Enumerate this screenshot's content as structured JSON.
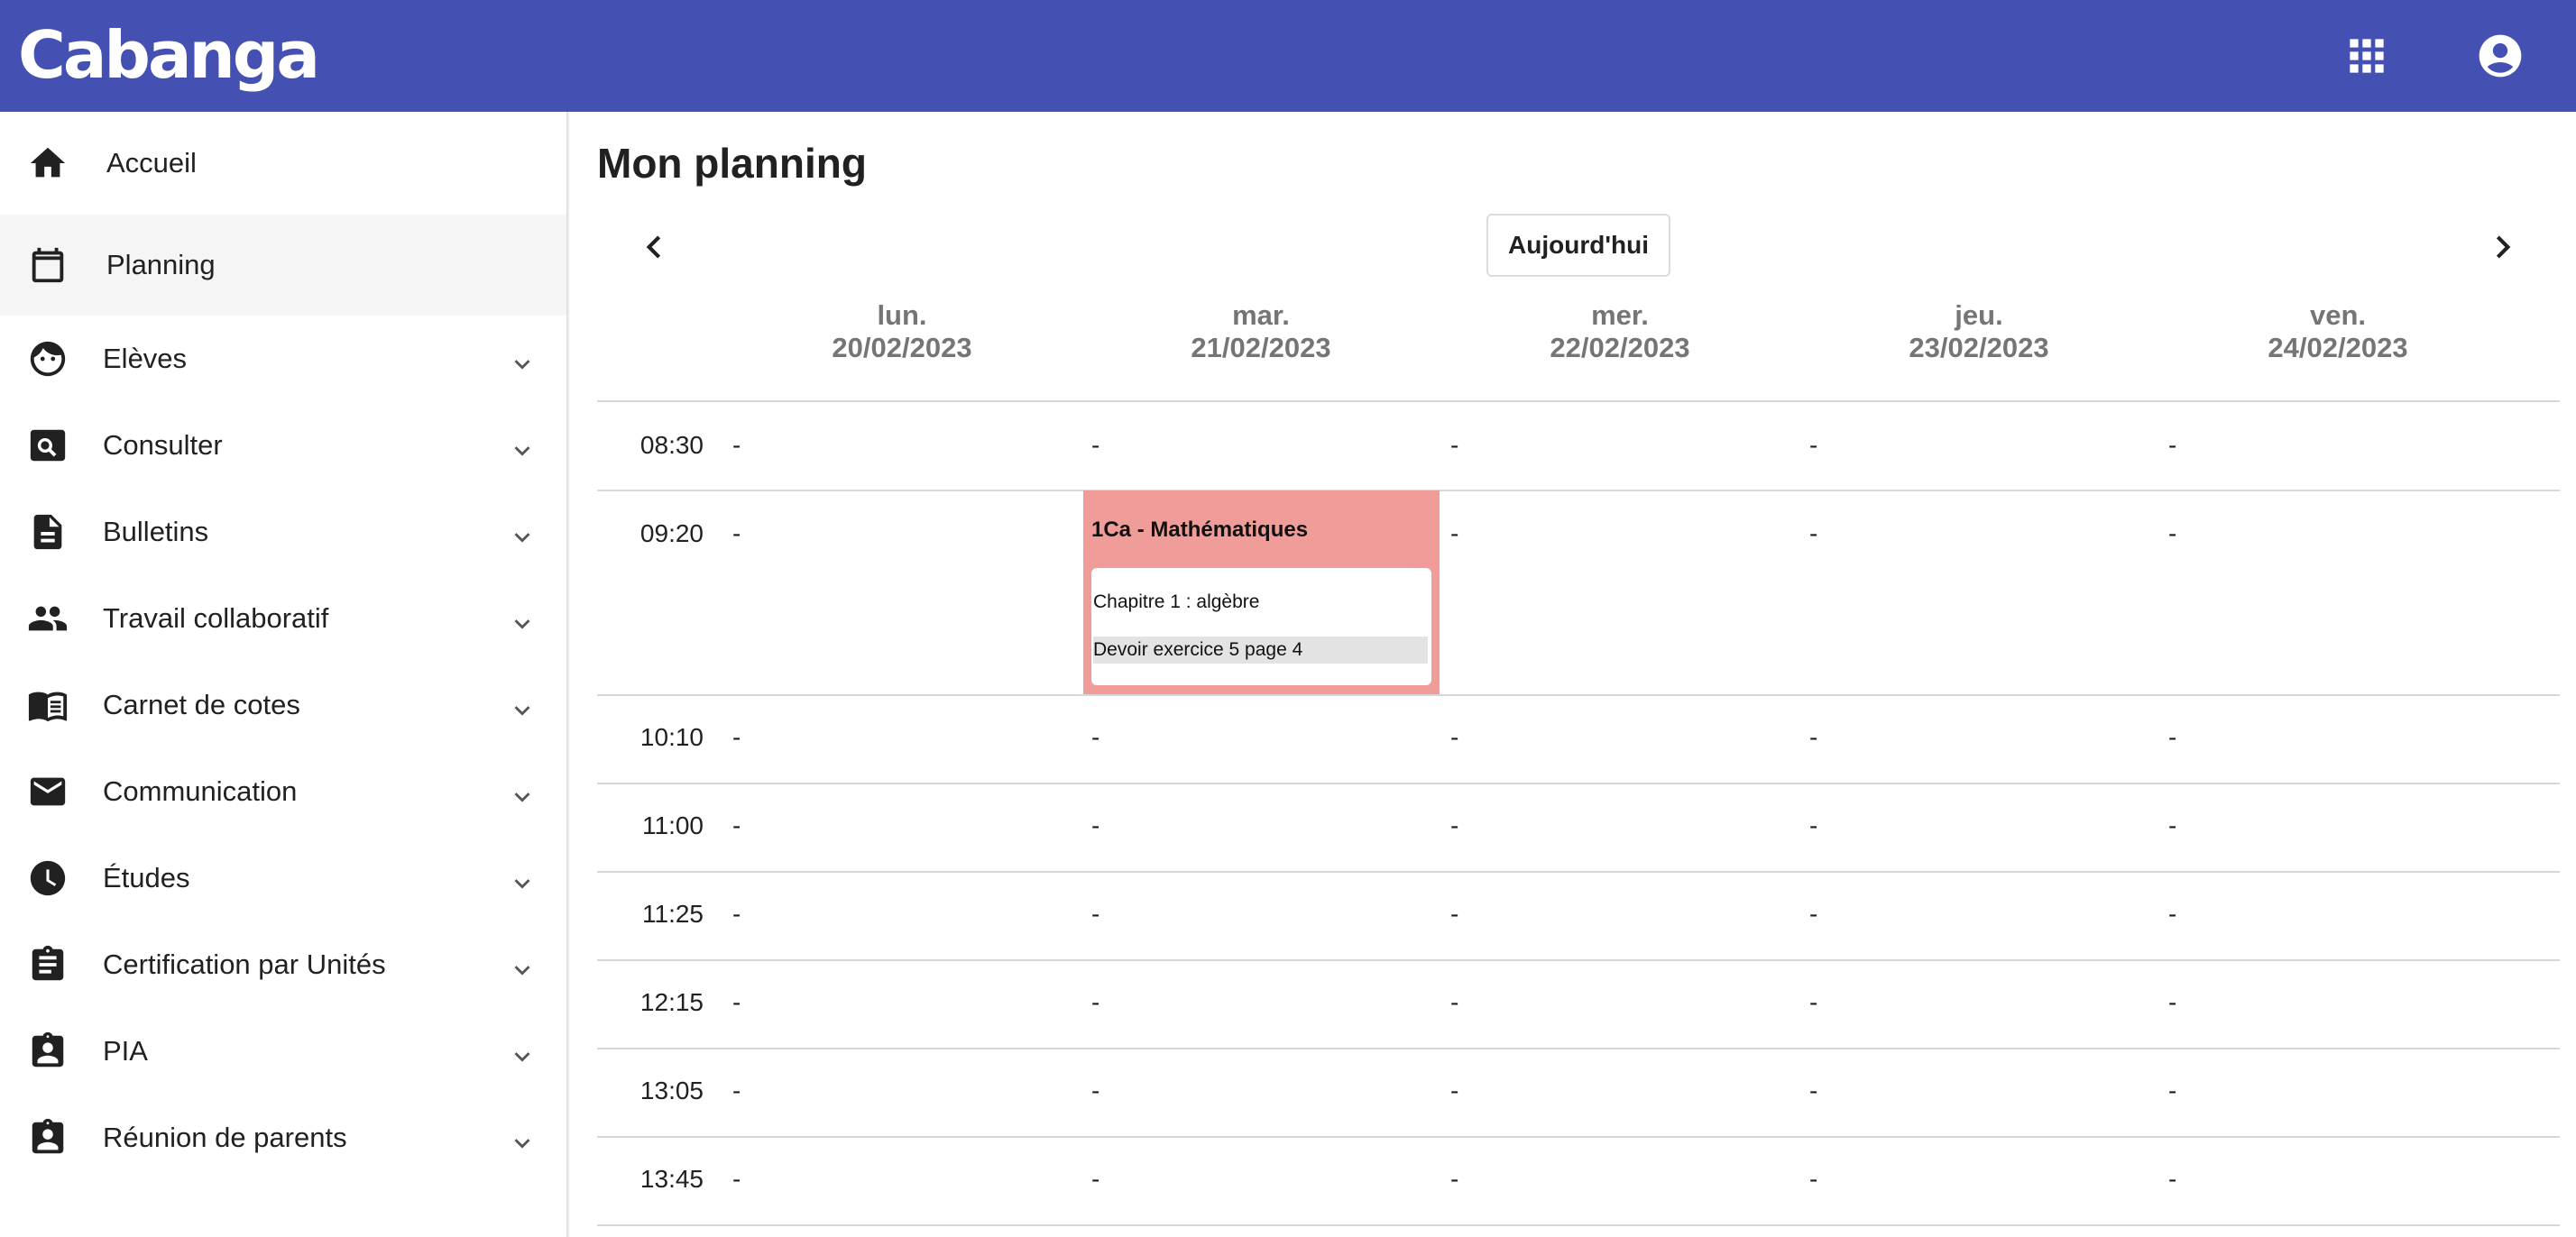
{
  "app": {
    "logo_text": "Cabanga",
    "brand_color": "#4450b2"
  },
  "header": {
    "apps_icon": "apps-grid-icon",
    "account_icon": "account-circle-icon"
  },
  "sidebar": {
    "items": [
      {
        "label": "Accueil",
        "icon": "home-icon",
        "expandable": false,
        "active": false
      },
      {
        "label": "Planning",
        "icon": "calendar-icon",
        "expandable": false,
        "active": true
      },
      {
        "label": "Elèves",
        "icon": "face-icon",
        "expandable": true,
        "active": false
      },
      {
        "label": "Consulter",
        "icon": "search-box-icon",
        "expandable": true,
        "active": false
      },
      {
        "label": "Bulletins",
        "icon": "document-icon",
        "expandable": true,
        "active": false
      },
      {
        "label": "Travail collaboratif",
        "icon": "people-icon",
        "expandable": true,
        "active": false
      },
      {
        "label": "Carnet de cotes",
        "icon": "book-icon",
        "expandable": true,
        "active": false
      },
      {
        "label": "Communication",
        "icon": "mail-icon",
        "expandable": true,
        "active": false
      },
      {
        "label": "Études",
        "icon": "clock-icon",
        "expandable": true,
        "active": false
      },
      {
        "label": "Certification par Unités",
        "icon": "clipboard-icon",
        "expandable": true,
        "active": false
      },
      {
        "label": "PIA",
        "icon": "badge-icon",
        "expandable": true,
        "active": false
      },
      {
        "label": "Réunion de parents",
        "icon": "badge-icon",
        "expandable": true,
        "active": false
      }
    ]
  },
  "planning": {
    "title": "Mon planning",
    "today_label": "Aujourd'hui",
    "days": [
      {
        "name": "lun.",
        "date": "20/02/2023"
      },
      {
        "name": "mar.",
        "date": "21/02/2023"
      },
      {
        "name": "mer.",
        "date": "22/02/2023"
      },
      {
        "name": "jeu.",
        "date": "23/02/2023"
      },
      {
        "name": "ven.",
        "date": "24/02/2023"
      }
    ],
    "empty_marker": "-",
    "slots": [
      {
        "time": "08:30",
        "cells": [
          "-",
          "-",
          "-",
          "-",
          "-"
        ]
      },
      {
        "time": "09:20",
        "cells": [
          "-",
          "",
          "-",
          "-",
          "-"
        ]
      },
      {
        "time": "10:10",
        "cells": [
          "-",
          "-",
          "-",
          "-",
          "-"
        ]
      },
      {
        "time": "11:00",
        "cells": [
          "-",
          "-",
          "-",
          "-",
          "-"
        ]
      },
      {
        "time": "11:25",
        "cells": [
          "-",
          "-",
          "-",
          "-",
          "-"
        ]
      },
      {
        "time": "12:15",
        "cells": [
          "-",
          "-",
          "-",
          "-",
          "-"
        ]
      },
      {
        "time": "13:05",
        "cells": [
          "-",
          "-",
          "-",
          "-",
          "-"
        ]
      },
      {
        "time": "13:45",
        "cells": [
          "-",
          "-",
          "-",
          "-",
          "-"
        ]
      }
    ],
    "event": {
      "title": "1Ca - Mathématiques",
      "chapter": "Chapitre 1 : algèbre",
      "homework": "Devoir exercice 5 page 4",
      "color": "#f09d9a"
    }
  }
}
